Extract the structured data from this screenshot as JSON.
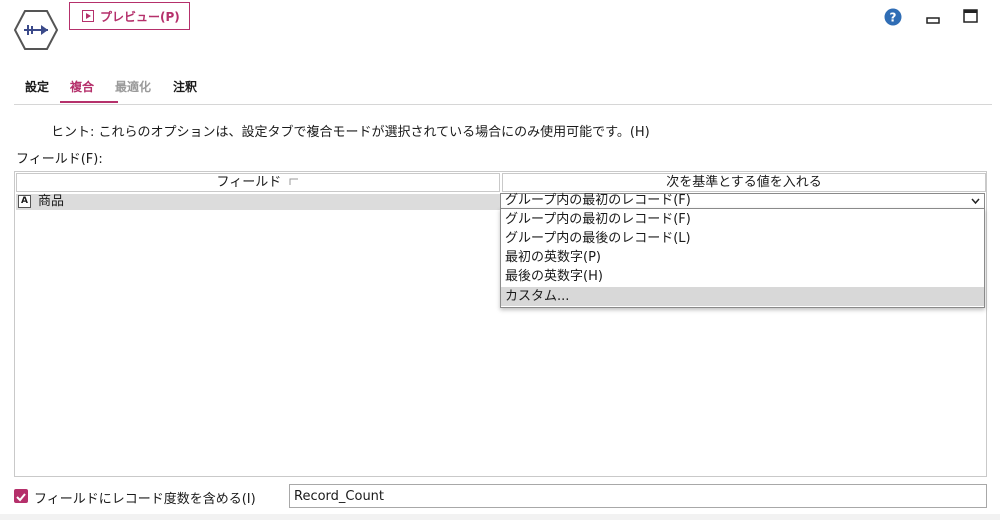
{
  "toolbar": {
    "preview_label": "プレビュー(P)",
    "node_icon": "aggregate-node-icon",
    "help_icon": "help-icon",
    "minimize_icon": "minimize-icon",
    "maximize_icon": "maximize-icon"
  },
  "tabs": [
    {
      "label": "設定",
      "state": "normal"
    },
    {
      "label": "複合",
      "state": "active"
    },
    {
      "label": "最適化",
      "state": "disabled"
    },
    {
      "label": "注釈",
      "state": "normal"
    }
  ],
  "hint": "ヒント: これらのオプションは、設定タブで複合モードが選択されている場合にのみ使用可能です。(H)",
  "fields_label": "フィールド(F):",
  "table": {
    "columns": [
      "フィールド",
      "次を基準とする値を入れる"
    ],
    "rows": [
      {
        "type_icon": "A",
        "field": "商品",
        "value": "グループ内の最初のレコード(F)"
      }
    ]
  },
  "dropdown": {
    "options": [
      "グループ内の最初のレコード(F)",
      "グループ内の最後のレコード(L)",
      "最初の英数字(P)",
      "最後の英数字(H)",
      "カスタム..."
    ],
    "highlighted_index": 4
  },
  "record_count": {
    "checked": true,
    "label": "フィールドにレコード度数を含める(I)",
    "value": "Record_Count"
  },
  "colors": {
    "accent": "#b5306b",
    "help": "#2f6db5"
  }
}
